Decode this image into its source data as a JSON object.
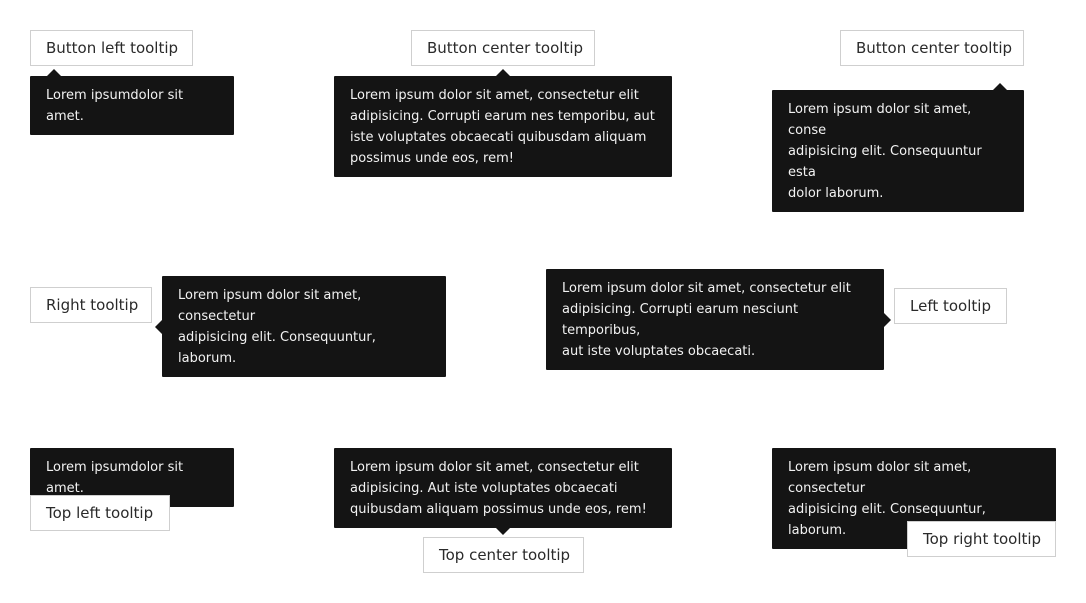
{
  "row1": {
    "bottom_left": {
      "button_label": "Button left tooltip",
      "tooltip_lines": [
        "Lorem ipsumdolor sit amet."
      ]
    },
    "bottom_center": {
      "button_label": "Button center tooltip",
      "tooltip_lines": [
        "Lorem ipsum dolor sit amet, consectetur elit",
        "adipisicing. Corrupti earum nes temporibu, aut",
        "iste voluptates obcaecati quibusdam aliquam",
        "possimus unde eos, rem!"
      ]
    },
    "bottom_right": {
      "button_label": "Button center tooltip",
      "tooltip_lines": [
        "Lorem ipsum dolor sit amet, conse",
        "adipisicing elit. Consequuntur esta",
        "dolor laborum."
      ]
    }
  },
  "row2": {
    "right": {
      "button_label": "Right tooltip",
      "tooltip_lines": [
        "Lorem ipsum dolor sit amet, consectetur",
        "adipisicing elit. Consequuntur, laborum."
      ]
    },
    "left": {
      "button_label": "Left tooltip",
      "tooltip_lines": [
        "Lorem ipsum dolor sit amet, consectetur elit",
        "adipisicing. Corrupti earum nesciunt temporibus,",
        "aut iste voluptates obcaecati."
      ]
    }
  },
  "row3": {
    "top_left": {
      "button_label": "Top left tooltip",
      "tooltip_lines": [
        "Lorem ipsumdolor sit amet."
      ]
    },
    "top_center": {
      "button_label": "Top center tooltip",
      "tooltip_lines": [
        "Lorem ipsum dolor sit amet, consectetur elit",
        "adipisicing. Aut iste voluptates obcaecati",
        "quibusdam aliquam possimus unde eos, rem!"
      ]
    },
    "top_right": {
      "button_label": "Top right tooltip",
      "tooltip_lines": [
        "Lorem ipsum dolor sit amet, consectetur",
        "adipisicing elit. Consequuntur, laborum."
      ]
    }
  },
  "colors": {
    "tooltip_background": "#141414",
    "tooltip_text": "#f2f2f2",
    "button_border": "#cfcfcf",
    "button_text": "#2a2a2a"
  }
}
